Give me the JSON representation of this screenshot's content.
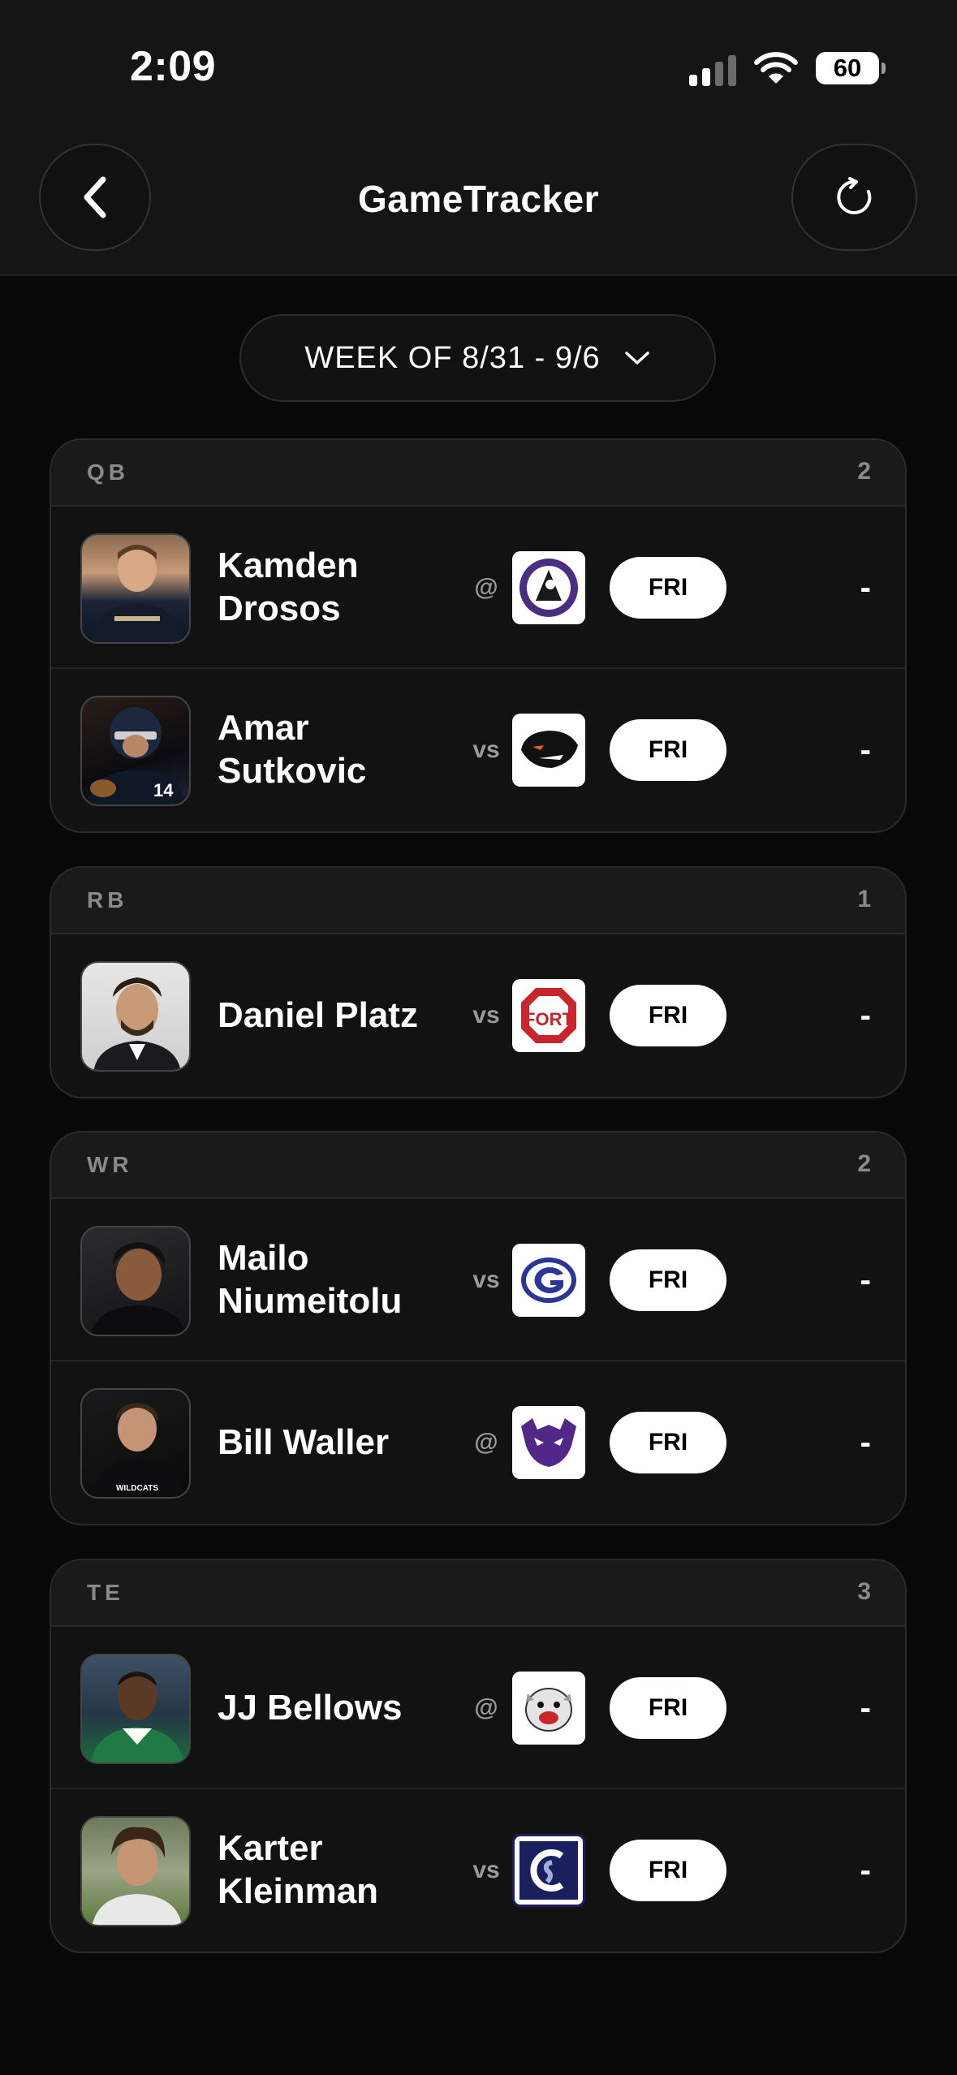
{
  "status_bar": {
    "time": "2:09",
    "battery": "60"
  },
  "header": {
    "title": "GameTracker"
  },
  "week_selector": {
    "label": "WEEK OF 8/31 - 9/6"
  },
  "sections": [
    {
      "position": "QB",
      "count": "2",
      "players": [
        {
          "name": "Kamden\nDrosos",
          "loc": "@",
          "day": "FRI",
          "score": "-"
        },
        {
          "name": "Amar\nSutkovic",
          "loc": "vs",
          "day": "FRI",
          "score": "-"
        }
      ]
    },
    {
      "position": "RB",
      "count": "1",
      "players": [
        {
          "name": "Daniel Platz",
          "loc": "vs",
          "day": "FRI",
          "score": "-"
        }
      ]
    },
    {
      "position": "WR",
      "count": "2",
      "players": [
        {
          "name": "Mailo\nNiumeitolu",
          "loc": "vs",
          "day": "FRI",
          "score": "-"
        },
        {
          "name": "Bill Waller",
          "loc": "@",
          "day": "FRI",
          "score": "-"
        }
      ]
    },
    {
      "position": "TE",
      "count": "3",
      "players": [
        {
          "name": "JJ Bellows",
          "loc": "@",
          "day": "FRI",
          "score": "-"
        },
        {
          "name": "Karter\nKleinman",
          "loc": "vs",
          "day": "FRI",
          "score": "-"
        }
      ]
    }
  ]
}
